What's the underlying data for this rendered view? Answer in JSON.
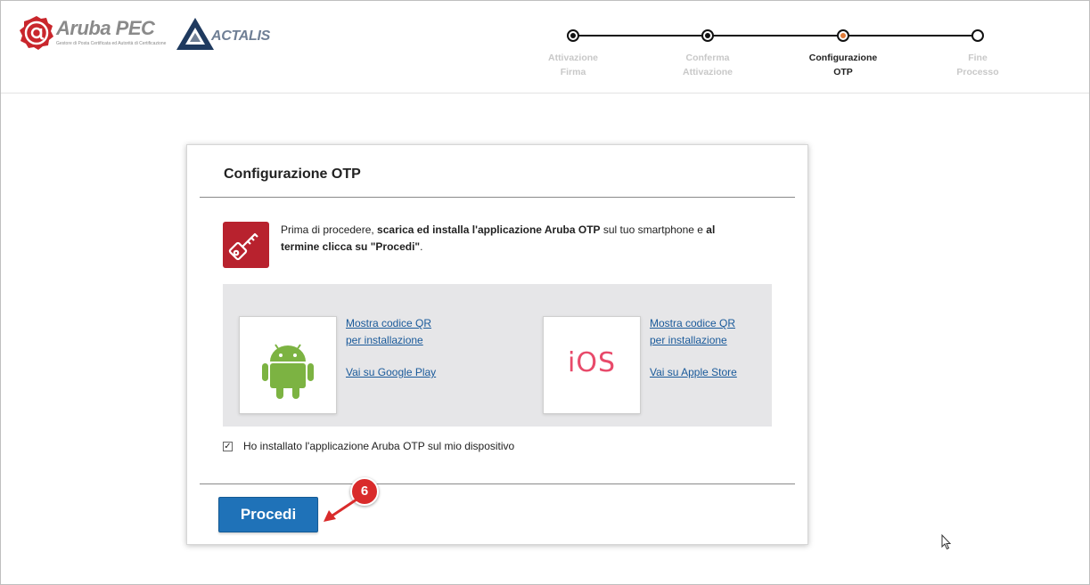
{
  "header": {
    "aruba_logo": {
      "brand": "Aruba PEC",
      "tagline": "Gestore di Posta Certificata ed Autorità di Certificazione"
    },
    "actalis_logo": {
      "name": "ACTALIS"
    }
  },
  "stepper": {
    "steps": [
      {
        "line1": "Attivazione",
        "line2": "Firma",
        "state": "done"
      },
      {
        "line1": "Conferma",
        "line2": "Attivazione",
        "state": "done"
      },
      {
        "line1": "Configurazione",
        "line2": "OTP",
        "state": "current"
      },
      {
        "line1": "Fine",
        "line2": "Processo",
        "state": "todo"
      }
    ]
  },
  "card": {
    "title": "Configurazione OTP",
    "intro": {
      "p1": "Prima di procedere, ",
      "b1": "scarica ed installa l'applicazione Aruba OTP",
      "p2": " sul tuo smartphone e ",
      "b2": "al termine clicca su \"Procedi\"",
      "p3": "."
    },
    "android": {
      "qr_link_line1": "Mostra codice QR",
      "qr_link_line2": "per installazione",
      "store_link": "Vai su Google Play",
      "icon": "android-icon"
    },
    "ios": {
      "logo_text": "iOS",
      "qr_link_line1": "Mostra codice QR",
      "qr_link_line2": "per installazione",
      "store_link": "Vai su Apple Store"
    },
    "checkbox": {
      "checked": true,
      "label": "Ho installato l'applicazione Aruba OTP sul mio dispositivo"
    },
    "proceed_button": "Procedi"
  },
  "annotation": {
    "number": "6"
  },
  "colors": {
    "primary_button": "#1f72b8",
    "key_tile": "#b8222e",
    "current_step": "#e07b39",
    "link": "#1a5a9a",
    "android_green": "#7cb342"
  }
}
